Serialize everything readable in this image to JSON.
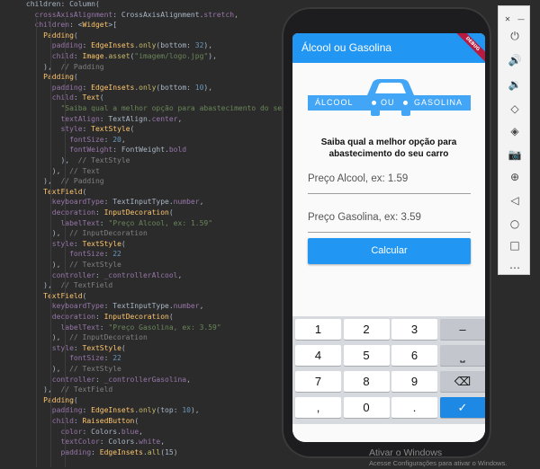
{
  "editor": {
    "lines": [
      [
        [
          "tok-plain",
          "      "
        ],
        [
          "tok-plain",
          "children: Column("
        ]
      ],
      [
        [
          "tok-plain",
          "        "
        ],
        [
          "tok-prop",
          "crossAxisAlignment"
        ],
        [
          "tok-plain",
          ": CrossAxisAlignment."
        ],
        [
          "tok-prop",
          "stretch"
        ],
        [
          "tok-plain",
          ","
        ]
      ],
      [
        [
          "tok-plain",
          "        "
        ],
        [
          "tok-prop",
          "children"
        ],
        [
          "tok-plain",
          ": <"
        ],
        [
          "tok-cls",
          "Widget"
        ],
        [
          "tok-plain",
          ">["
        ]
      ],
      [
        [
          "tok-plain",
          "          "
        ],
        [
          "tok-cls",
          "Padding"
        ],
        [
          "tok-plain",
          "("
        ]
      ],
      [
        [
          "tok-plain",
          "            "
        ],
        [
          "tok-prop",
          "padding"
        ],
        [
          "tok-plain",
          ": "
        ],
        [
          "tok-cls",
          "EdgeInsets"
        ],
        [
          "tok-plain",
          "."
        ],
        [
          "tok-fn",
          "only"
        ],
        [
          "tok-plain",
          "(bottom: "
        ],
        [
          "tok-num",
          "32"
        ],
        [
          "tok-plain",
          "),"
        ]
      ],
      [
        [
          "tok-plain",
          "            "
        ],
        [
          "tok-prop",
          "child"
        ],
        [
          "tok-plain",
          ": "
        ],
        [
          "tok-cls",
          "Image"
        ],
        [
          "tok-plain",
          "."
        ],
        [
          "tok-fn",
          "asset"
        ],
        [
          "tok-plain",
          "("
        ],
        [
          "tok-str",
          "\"imagem/logo.jpg\""
        ],
        [
          "tok-plain",
          "),"
        ]
      ],
      [
        [
          "tok-plain",
          "          "
        ],
        [
          "tok-plain",
          "),  "
        ],
        [
          "tok-cmt",
          "// Padding"
        ]
      ],
      [
        [
          "tok-plain",
          "          "
        ],
        [
          "tok-cls",
          "Padding"
        ],
        [
          "tok-plain",
          "("
        ]
      ],
      [
        [
          "tok-plain",
          "            "
        ],
        [
          "tok-prop",
          "padding"
        ],
        [
          "tok-plain",
          ": "
        ],
        [
          "tok-cls",
          "EdgeInsets"
        ],
        [
          "tok-plain",
          "."
        ],
        [
          "tok-fn",
          "only"
        ],
        [
          "tok-plain",
          "(bottom: "
        ],
        [
          "tok-num",
          "10"
        ],
        [
          "tok-plain",
          "),"
        ]
      ],
      [
        [
          "tok-plain",
          "            "
        ],
        [
          "tok-prop",
          "child"
        ],
        [
          "tok-plain",
          ": "
        ],
        [
          "tok-cls",
          "Text"
        ],
        [
          "tok-plain",
          "("
        ]
      ],
      [
        [
          "tok-plain",
          "              "
        ],
        [
          "tok-str",
          "\"Saiba qual a melhor opção para abastecimento do se"
        ]
      ],
      [
        [
          "tok-plain",
          "              "
        ],
        [
          "tok-prop",
          "textAlign"
        ],
        [
          "tok-plain",
          ": TextAlign."
        ],
        [
          "tok-prop",
          "center"
        ],
        [
          "tok-plain",
          ","
        ]
      ],
      [
        [
          "tok-plain",
          "              "
        ],
        [
          "tok-prop",
          "style"
        ],
        [
          "tok-plain",
          ": "
        ],
        [
          "tok-cls",
          "TextStyle"
        ],
        [
          "tok-plain",
          "("
        ]
      ],
      [
        [
          "tok-plain",
          "                "
        ],
        [
          "tok-prop",
          "fontSize"
        ],
        [
          "tok-plain",
          ": "
        ],
        [
          "tok-num",
          "20"
        ],
        [
          "tok-plain",
          ","
        ]
      ],
      [
        [
          "tok-plain",
          "                "
        ],
        [
          "tok-prop",
          "fontWeight"
        ],
        [
          "tok-plain",
          ": FontWeight."
        ],
        [
          "tok-prop",
          "bold"
        ]
      ],
      [
        [
          "tok-plain",
          "              "
        ],
        [
          "tok-plain",
          "),  "
        ],
        [
          "tok-cmt",
          "// TextStyle"
        ]
      ],
      [
        [
          "tok-plain",
          "            "
        ],
        [
          "tok-plain",
          "),  "
        ],
        [
          "tok-cmt",
          "// Text"
        ]
      ],
      [
        [
          "tok-plain",
          "          "
        ],
        [
          "tok-plain",
          "),  "
        ],
        [
          "tok-cmt",
          "// Padding"
        ]
      ],
      [
        [
          "tok-plain",
          "          "
        ],
        [
          "tok-cls",
          "TextField"
        ],
        [
          "tok-plain",
          "("
        ]
      ],
      [
        [
          "tok-plain",
          "            "
        ],
        [
          "tok-prop",
          "keyboardType"
        ],
        [
          "tok-plain",
          ": TextInputType."
        ],
        [
          "tok-prop",
          "number"
        ],
        [
          "tok-plain",
          ","
        ]
      ],
      [
        [
          "tok-plain",
          "            "
        ],
        [
          "tok-prop",
          "decoration"
        ],
        [
          "tok-plain",
          ": "
        ],
        [
          "tok-cls",
          "InputDecoration"
        ],
        [
          "tok-plain",
          "("
        ]
      ],
      [
        [
          "tok-plain",
          "              "
        ],
        [
          "tok-prop",
          "labelText"
        ],
        [
          "tok-plain",
          ": "
        ],
        [
          "tok-str",
          "\"Preço Alcool, ex: 1.59\""
        ]
      ],
      [
        [
          "tok-plain",
          "            "
        ],
        [
          "tok-plain",
          "),  "
        ],
        [
          "tok-cmt",
          "// InputDecoration"
        ]
      ],
      [
        [
          "tok-plain",
          "            "
        ],
        [
          "tok-prop",
          "style"
        ],
        [
          "tok-plain",
          ": "
        ],
        [
          "tok-cls",
          "TextStyle"
        ],
        [
          "tok-plain",
          "("
        ]
      ],
      [
        [
          "tok-plain",
          "                "
        ],
        [
          "tok-prop",
          "fontSize"
        ],
        [
          "tok-plain",
          ": "
        ],
        [
          "tok-num",
          "22"
        ]
      ],
      [
        [
          "tok-plain",
          "            "
        ],
        [
          "tok-plain",
          "),  "
        ],
        [
          "tok-cmt",
          "// TextStyle"
        ]
      ],
      [
        [
          "tok-plain",
          "            "
        ],
        [
          "tok-prop",
          "controller"
        ],
        [
          "tok-plain",
          ": "
        ],
        [
          "tok-prop",
          "_controllerAlcool"
        ],
        [
          "tok-plain",
          ","
        ]
      ],
      [
        [
          "tok-plain",
          "          "
        ],
        [
          "tok-plain",
          "),  "
        ],
        [
          "tok-cmt",
          "// TextField"
        ]
      ],
      [
        [
          "tok-plain",
          "          "
        ],
        [
          "tok-cls",
          "TextField"
        ],
        [
          "tok-plain",
          "("
        ]
      ],
      [
        [
          "tok-plain",
          "            "
        ],
        [
          "tok-prop",
          "keyboardType"
        ],
        [
          "tok-plain",
          ": TextInputType."
        ],
        [
          "tok-prop",
          "number"
        ],
        [
          "tok-plain",
          ","
        ]
      ],
      [
        [
          "tok-plain",
          "            "
        ],
        [
          "tok-prop",
          "decoration"
        ],
        [
          "tok-plain",
          ": "
        ],
        [
          "tok-cls",
          "InputDecoration"
        ],
        [
          "tok-plain",
          "("
        ]
      ],
      [
        [
          "tok-plain",
          "              "
        ],
        [
          "tok-prop",
          "labelText"
        ],
        [
          "tok-plain",
          ": "
        ],
        [
          "tok-str",
          "\"Preço Gasolina, ex: 3.59\""
        ]
      ],
      [
        [
          "tok-plain",
          "            "
        ],
        [
          "tok-plain",
          "),  "
        ],
        [
          "tok-cmt",
          "// InputDecoration"
        ]
      ],
      [
        [
          "tok-plain",
          "            "
        ],
        [
          "tok-prop",
          "style"
        ],
        [
          "tok-plain",
          ": "
        ],
        [
          "tok-cls",
          "TextStyle"
        ],
        [
          "tok-plain",
          "("
        ]
      ],
      [
        [
          "tok-plain",
          "                "
        ],
        [
          "tok-prop",
          "fontSize"
        ],
        [
          "tok-plain",
          ": "
        ],
        [
          "tok-num",
          "22"
        ]
      ],
      [
        [
          "tok-plain",
          "            "
        ],
        [
          "tok-plain",
          "),  "
        ],
        [
          "tok-cmt",
          "// TextStyle"
        ]
      ],
      [
        [
          "tok-plain",
          "            "
        ],
        [
          "tok-prop",
          "controller"
        ],
        [
          "tok-plain",
          ": "
        ],
        [
          "tok-prop",
          "_controllerGasolina"
        ],
        [
          "tok-plain",
          ","
        ]
      ],
      [
        [
          "tok-plain",
          "          "
        ],
        [
          "tok-plain",
          "),  "
        ],
        [
          "tok-cmt",
          "// TextField"
        ]
      ],
      [
        [
          "tok-plain",
          "          "
        ],
        [
          "tok-cls",
          "Padding"
        ],
        [
          "tok-plain",
          "("
        ]
      ],
      [
        [
          "tok-plain",
          "            "
        ],
        [
          "tok-prop",
          "padding"
        ],
        [
          "tok-plain",
          ": "
        ],
        [
          "tok-cls",
          "EdgeInsets"
        ],
        [
          "tok-plain",
          "."
        ],
        [
          "tok-fn",
          "only"
        ],
        [
          "tok-plain",
          "(top: "
        ],
        [
          "tok-num",
          "10"
        ],
        [
          "tok-plain",
          "),"
        ]
      ],
      [
        [
          "tok-plain",
          "            "
        ],
        [
          "tok-prop",
          "child"
        ],
        [
          "tok-plain",
          ": "
        ],
        [
          "tok-cls",
          "RaisedButton"
        ],
        [
          "tok-plain",
          "("
        ]
      ],
      [
        [
          "tok-plain",
          "              "
        ],
        [
          "tok-prop",
          "color"
        ],
        [
          "tok-plain",
          ": Colors."
        ],
        [
          "tok-prop",
          "blue"
        ],
        [
          "tok-plain",
          ","
        ]
      ],
      [
        [
          "tok-plain",
          "              "
        ],
        [
          "tok-prop",
          "textColor"
        ],
        [
          "tok-plain",
          ": Colors."
        ],
        [
          "tok-prop",
          "white"
        ],
        [
          "tok-plain",
          ","
        ]
      ],
      [
        [
          "tok-plain",
          "              "
        ],
        [
          "tok-prop",
          "padding"
        ],
        [
          "tok-plain",
          ": "
        ],
        [
          "tok-cls",
          "EdgeInsets"
        ],
        [
          "tok-plain",
          "."
        ],
        [
          "tok-fn",
          "all"
        ],
        [
          "tok-plain",
          "(15)"
        ]
      ]
    ]
  },
  "app": {
    "title": "Álcool ou Gasolina",
    "debug_banner": "DEBUG",
    "logo": {
      "left_word": "ÁLCOOL",
      "mid_word": "OU",
      "right_word": "GASOLINA"
    },
    "headline": "Saiba qual a melhor opção para abastecimento do seu carro",
    "field_alcool_label": "Preço Alcool, ex: 1.59",
    "field_gasolina_label": "Preço Gasolina, ex: 3.59",
    "calc_label": "Calcular",
    "primary_color": "#2196f3"
  },
  "keyboard": {
    "rows": [
      [
        "1",
        "2",
        "3",
        "–"
      ],
      [
        "4",
        "5",
        "6",
        "⎵"
      ],
      [
        "7",
        "8",
        "9",
        "⌫"
      ],
      [
        ",",
        "0",
        ".",
        "✓"
      ]
    ]
  },
  "toolbar": {
    "icons": [
      "close-icon",
      "minimize-icon",
      "power-icon",
      "volume-up-icon",
      "volume-down-icon",
      "rotate-left-icon",
      "rotate-right-icon",
      "camera-icon",
      "zoom-icon",
      "back-icon",
      "home-icon",
      "overview-icon",
      "more-icon"
    ],
    "glyphs": [
      "✕",
      "—",
      "⏻",
      "🔊",
      "🔉",
      "◇",
      "◈",
      "📷",
      "⊕",
      "◁",
      "○",
      "□",
      "⋯"
    ]
  },
  "watermark": {
    "title": "Ativar o Windows",
    "subtitle": "Acesse Configurações para ativar o Windows."
  }
}
